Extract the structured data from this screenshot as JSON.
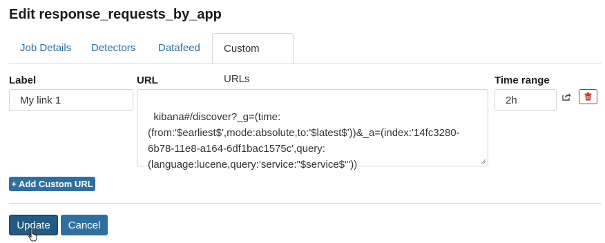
{
  "page": {
    "title": "Edit response_requests_by_app"
  },
  "tabs": [
    {
      "label": "Job Details"
    },
    {
      "label": "Detectors"
    },
    {
      "label": "Datafeed"
    },
    {
      "label": "Custom URLs",
      "active": true
    }
  ],
  "custom_url": {
    "label_header": "Label",
    "url_header": "URL",
    "time_range_header": "Time range",
    "label_value": "My link 1",
    "url_value": "kibana#/discover?_g=(time:\n(from:'$earliest$',mode:absolute,to:'$latest$'))&_a=(index:'14fc3280-\n6b78-11e8-a164-6df1bac1575c',query:\n(language:lucene,query:'service:\"$service$\"'))",
    "time_range_value": "2h"
  },
  "add_button": {
    "label": "+ Add Custom URL"
  },
  "footer": {
    "update_label": "Update",
    "cancel_label": "Cancel"
  },
  "icons": {
    "test": "share-icon",
    "delete": "trash-icon",
    "cursor": "hand-pointer-icon"
  },
  "colors": {
    "primary": "#2f6f9f",
    "primary_dark": "#245a82",
    "danger": "#bd271e",
    "tab_text": "#2f6f9f",
    "border": "#cfd3d8"
  }
}
